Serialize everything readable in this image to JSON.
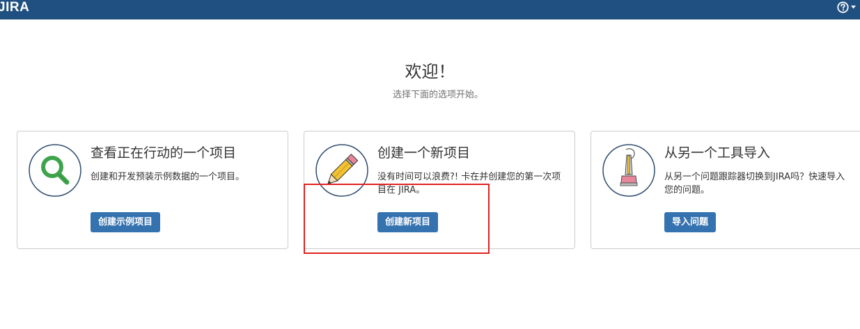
{
  "header": {
    "logo_text": "JIRA",
    "background_color": "#205081",
    "help_icon": "help-icon",
    "menu_icon": "caret-down-icon"
  },
  "welcome": {
    "title": "欢迎！",
    "subtitle": "选择下面的选项开始。"
  },
  "cards": [
    {
      "icon": "magnifier-icon",
      "title": "查看正在行动的一个项目",
      "description": "创建和开发预装示例数据的一个项目。",
      "button_label": "创建示例项目"
    },
    {
      "icon": "pencil-icon",
      "title": "创建一个新项目",
      "description": "没有时间可以浪费?! 卡在并创建您的第一次项目在 JIRA。",
      "button_label": "创建新项目"
    },
    {
      "icon": "vacuum-cleaner-icon",
      "title": "从另一个工具导入",
      "description": "从另一个问题跟踪器切换到JIRA吗？快速导入您的问题。",
      "button_label": "导入问题"
    }
  ],
  "colors": {
    "button": "#3572b0",
    "highlight": "#e02020",
    "card_border": "#cccccc"
  }
}
